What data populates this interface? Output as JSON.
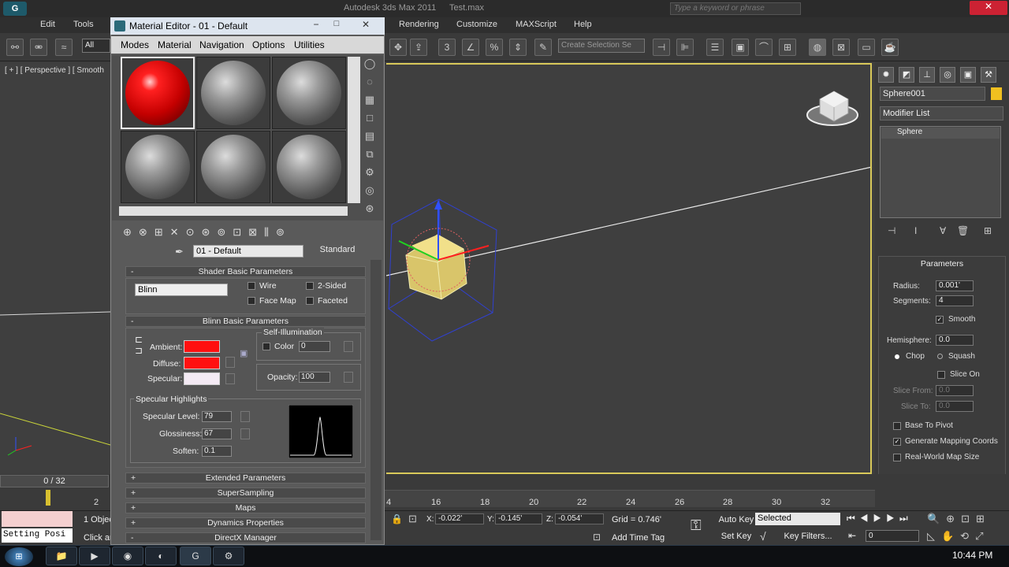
{
  "window": {
    "title": "Autodesk 3ds Max 2011",
    "file": "Test.max",
    "search_placeholder": "Type a keyword or phrase"
  },
  "menubar": [
    "Edit",
    "Tools",
    "Rendering",
    "Customize",
    "MAXScript",
    "Help"
  ],
  "toolbar": {
    "filter": "All",
    "selection_set": "Create Selection Se"
  },
  "viewport": {
    "label": "[ + ] [ Perspective ] [ Smooth"
  },
  "material_editor": {
    "title": "Material Editor - 01 - Default",
    "menu": [
      "Modes",
      "Material",
      "Navigation",
      "Options",
      "Utilities"
    ],
    "material_name": "01 - Default",
    "material_type": "Standard",
    "shader_rollout": "Shader Basic Parameters",
    "shader": "Blinn",
    "shader_opts": {
      "wire": "Wire",
      "two_sided": "2-Sided",
      "face_map": "Face Map",
      "faceted": "Faceted"
    },
    "blinn_rollout": "Blinn Basic Parameters",
    "self_illum": "Self-Illumination",
    "color_label": "Color",
    "color_value": "0",
    "ambient": "Ambient:",
    "diffuse": "Diffuse:",
    "specular": "Specular:",
    "ambient_color": "#ff1010",
    "diffuse_color": "#ff1010",
    "specular_color": "#f4eaf4",
    "opacity_label": "Opacity:",
    "opacity": "100",
    "spec_highlights": "Specular Highlights",
    "spec_level_label": "Specular Level:",
    "spec_level": "79",
    "gloss_label": "Glossiness:",
    "gloss": "67",
    "soften_label": "Soften:",
    "soften": "0.1",
    "rollouts": [
      "Extended Parameters",
      "SuperSampling",
      "Maps",
      "Dynamics Properties",
      "DirectX Manager"
    ],
    "rollout_signs": [
      "+",
      "+",
      "+",
      "+",
      "-"
    ],
    "minus": "-"
  },
  "command_panel": {
    "object_name": "Sphere001",
    "object_color": "#f0c020",
    "modifier_list": "Modifier List",
    "stack_item": "Sphere",
    "params_title": "Parameters",
    "radius_label": "Radius:",
    "radius": "0.001'",
    "segments_label": "Segments:",
    "segments": "4",
    "smooth": "Smooth",
    "hemisphere_label": "Hemisphere:",
    "hemisphere": "0.0",
    "chop": "Chop",
    "squash": "Squash",
    "slice_on": "Slice On",
    "slice_from_label": "Slice From:",
    "slice_from": "0.0",
    "slice_to_label": "Slice To:",
    "slice_to": "0.0",
    "base_to_pivot": "Base To Pivot",
    "gen_mapping": "Generate Mapping Coords",
    "real_world": "Real-World Map Size"
  },
  "timeline": {
    "frame": "0 / 32",
    "ticks": [
      "2",
      "4",
      "16",
      "18",
      "20",
      "22",
      "24",
      "26",
      "28",
      "30",
      "32"
    ]
  },
  "status": {
    "objects": "1 Objec",
    "prompt": "Click an",
    "setting": "Setting Posi",
    "x": "-0.022'",
    "y": "-0.145'",
    "z": "-0.054'",
    "grid": "Grid = 0.746'",
    "add_time_tag": "Add Time Tag",
    "auto_key": "Auto Key",
    "set_key": "Set Key",
    "selected": "Selected",
    "key_filters": "Key Filters...",
    "frame_field": "0"
  },
  "clock": "10:44 PM"
}
